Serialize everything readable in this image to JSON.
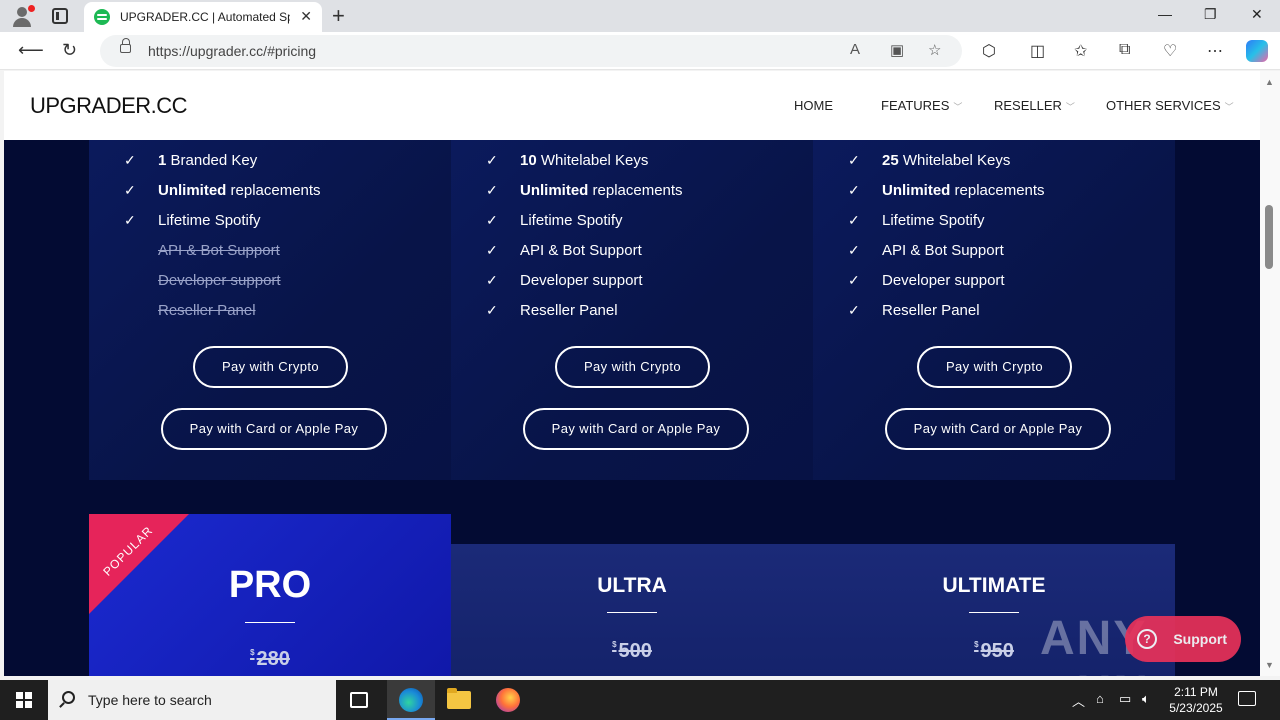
{
  "browser": {
    "tab_title": "UPGRADER.CC | Automated Spotify",
    "tab_close": "✕",
    "new_tab": "+",
    "url": "https://upgrader.cc/#pricing",
    "controls": {
      "minimize": "—",
      "maximize": "❐",
      "close": "✕"
    }
  },
  "site": {
    "logo": "UPGRADER.CC",
    "menu": [
      "HOME",
      "FEATURES",
      "RESELLER",
      "OTHER SERVICES"
    ]
  },
  "plans_top": [
    {
      "features": [
        {
          "bold": "1",
          "text": " Branded Key",
          "enabled": true
        },
        {
          "bold": "Unlimited",
          "text": " replacements",
          "enabled": true
        },
        {
          "bold": "",
          "text": "Lifetime Spotify",
          "enabled": true
        },
        {
          "bold": "",
          "text": "API & Bot Support",
          "enabled": false
        },
        {
          "bold": "",
          "text": "Developer support",
          "enabled": false
        },
        {
          "bold": "",
          "text": "Reseller Panel",
          "enabled": false
        }
      ],
      "crypto_btn": "Pay with Crypto",
      "card_btn": "Pay with Card or Apple Pay"
    },
    {
      "features": [
        {
          "bold": "10",
          "text": " Whitelabel Keys",
          "enabled": true
        },
        {
          "bold": "Unlimited",
          "text": " replacements",
          "enabled": true
        },
        {
          "bold": "",
          "text": "Lifetime Spotify",
          "enabled": true
        },
        {
          "bold": "",
          "text": "API & Bot Support",
          "enabled": true
        },
        {
          "bold": "",
          "text": "Developer support",
          "enabled": true
        },
        {
          "bold": "",
          "text": "Reseller Panel",
          "enabled": true
        }
      ],
      "crypto_btn": "Pay with Crypto",
      "card_btn": "Pay with Card or Apple Pay"
    },
    {
      "features": [
        {
          "bold": "25",
          "text": " Whitelabel Keys",
          "enabled": true
        },
        {
          "bold": "Unlimited",
          "text": " replacements",
          "enabled": true
        },
        {
          "bold": "",
          "text": "Lifetime Spotify",
          "enabled": true
        },
        {
          "bold": "",
          "text": "API & Bot Support",
          "enabled": true
        },
        {
          "bold": "",
          "text": "Developer support",
          "enabled": true
        },
        {
          "bold": "",
          "text": "Reseller Panel",
          "enabled": true
        }
      ],
      "crypto_btn": "Pay with Crypto",
      "card_btn": "Pay with Card or Apple Pay"
    }
  ],
  "plans_bottom": [
    {
      "name": "PRO",
      "price": "280",
      "currency": "$",
      "ribbon": "POPULAR"
    },
    {
      "name": "ULTRA",
      "price": "500",
      "currency": "$"
    },
    {
      "name": "ULTIMATE",
      "price": "950",
      "currency": "$"
    }
  ],
  "overlay": {
    "watermark": "ANY RUN",
    "support": "Support",
    "support_icon": "?"
  },
  "taskbar": {
    "search_placeholder": "Type here to search",
    "time": "2:11 PM",
    "date": "5/23/2025"
  },
  "colors": {
    "page_bg": "#030b33",
    "card_bg": "#0b1a5c",
    "pro_bg": "#1b2ad0",
    "ribbon": "#e6245a",
    "support": "#e8325a"
  }
}
